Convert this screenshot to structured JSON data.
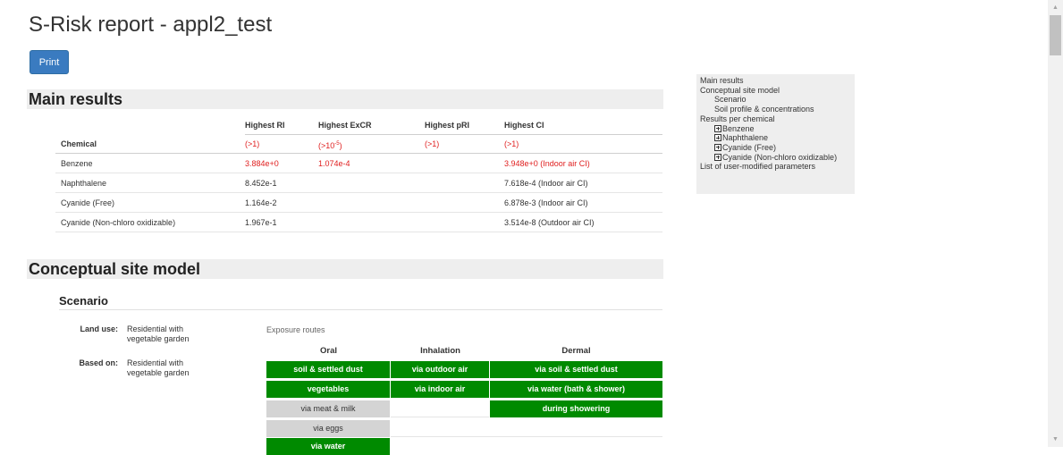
{
  "page": {
    "title": "S-Risk report - appl2_test",
    "print_label": "Print"
  },
  "main_results": {
    "heading": "Main results",
    "columns": [
      "Highest RI",
      "Highest ExCR",
      "Highest pRI",
      "Highest CI"
    ],
    "row_header": "Chemical",
    "thresholds": [
      "(>1)",
      "(>10",
      "-5",
      ")",
      "(>1)",
      "(>1)"
    ],
    "rows": [
      {
        "chemical": "Benzene",
        "ri": "3.884e+0",
        "excr": "1.074e-4",
        "pri": "",
        "ci": "3.948e+0 (Indoor air CI)"
      },
      {
        "chemical": "Naphthalene",
        "ri": "8.452e-1",
        "excr": "",
        "pri": "",
        "ci": "7.618e-4 (Indoor air CI)"
      },
      {
        "chemical": "Cyanide (Free)",
        "ri": "1.164e-2",
        "excr": "",
        "pri": "",
        "ci": "6.878e-3 (Indoor air CI)"
      },
      {
        "chemical": "Cyanide (Non-chloro oxidizable)",
        "ri": "1.967e-1",
        "excr": "",
        "pri": "",
        "ci": "3.514e-8 (Outdoor air CI)"
      }
    ]
  },
  "toc": {
    "items": [
      "Main results",
      "Conceptual site model",
      "Scenario",
      "Soil profile & concentrations",
      "Results per chemical",
      "Benzene",
      "Naphthalene",
      "Cyanide (Free)",
      "Cyanide (Non-chloro oxidizable)",
      "List of user-modified parameters"
    ]
  },
  "csm": {
    "heading": "Conceptual site model",
    "scenario": {
      "title": "Scenario",
      "land_use_label": "Land use:",
      "land_use_value": "Residential with vegetable garden",
      "based_on_label": "Based on:",
      "based_on_value": "Residential with vegetable garden"
    },
    "routes": {
      "caption": "Exposure routes",
      "headers": [
        "Oral",
        "Inhalation",
        "Dermal"
      ],
      "oral": [
        "soil & settled dust",
        "vegetables",
        "via meat & milk",
        "via eggs",
        "via water"
      ],
      "inhalation": [
        "via outdoor air",
        "via indoor air"
      ],
      "dermal": [
        "via soil & settled dust",
        "via water (bath & shower)",
        "during showering"
      ]
    }
  },
  "colors": {
    "active_route": "#008a00",
    "inactive_route": "#d4d4d4",
    "exceed": "#e02020",
    "button": "#3a7bc0"
  }
}
